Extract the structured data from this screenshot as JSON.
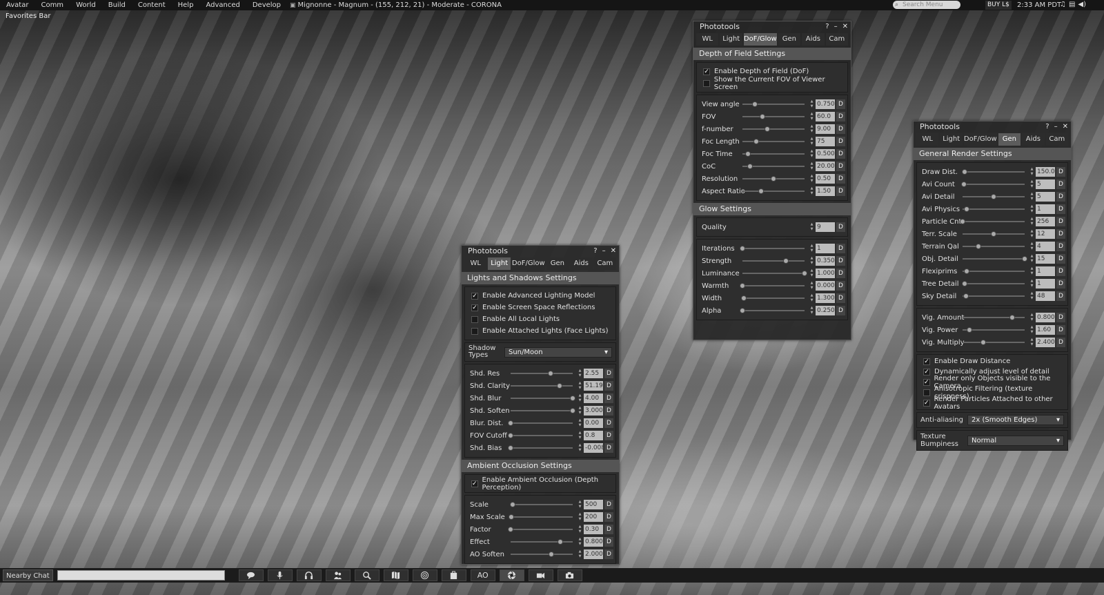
{
  "menubar": {
    "items": [
      "Avatar",
      "Comm",
      "World",
      "Build",
      "Content",
      "Help",
      "Advanced",
      "Develop"
    ],
    "location": "Mignonne - Magnum - (155, 212, 21) - Moderate - CORONA",
    "search_placeholder": "Search Menu",
    "buy_label": "BUY L$",
    "clock": "2:33 AM PDT"
  },
  "favorites_bar": "Favorites Bar",
  "tabs": [
    "WL",
    "Light",
    "DoF/Glow",
    "Gen",
    "Aids",
    "Cam"
  ],
  "light_panel": {
    "title": "Phototools",
    "active_tab": "Light",
    "section": "Lights and Shadows Settings",
    "checks": [
      {
        "label": "Enable Advanced Lighting Model",
        "checked": true
      },
      {
        "label": "Enable Screen Space Reflections",
        "checked": true
      },
      {
        "label": "Enable All Local Lights",
        "checked": false
      },
      {
        "label": "Enable Attached Lights (Face Lights)",
        "checked": false
      }
    ],
    "shadow_types_label": "Shadow Types",
    "shadow_types_value": "Sun/Moon",
    "sliders": [
      {
        "label": "Shd. Res",
        "value": "2.55",
        "pos": 0.64
      },
      {
        "label": "Shd. Clarity",
        "value": "51.19",
        "pos": 0.79
      },
      {
        "label": "Shd. Blur",
        "value": "4.00",
        "pos": 1.0
      },
      {
        "label": "Shd. Soften",
        "value": "3.000",
        "pos": 1.0
      },
      {
        "label": "Blur. Dist.",
        "value": "0.00",
        "pos": 0.0
      },
      {
        "label": "FOV Cutoff",
        "value": "0.8",
        "pos": 0.0
      },
      {
        "label": "Shd. Bias",
        "value": "-0.008",
        "pos": 0.0
      }
    ],
    "ao_section": "Ambient Occlusion Settings",
    "ao_check": {
      "label": "Enable Ambient Occlusion (Depth Perception)",
      "checked": true
    },
    "ao_sliders": [
      {
        "label": "Scale",
        "value": "500",
        "pos": 0.03
      },
      {
        "label": "Max Scale",
        "value": "200",
        "pos": 0.01
      },
      {
        "label": "Factor",
        "value": "0.30",
        "pos": 0.0
      },
      {
        "label": "Effect",
        "value": "0.800",
        "pos": 0.8
      },
      {
        "label": "AO Soften",
        "value": "2.000",
        "pos": 0.66
      }
    ]
  },
  "dof_panel": {
    "title": "Phototools",
    "active_tab": "DoF/Glow",
    "section": "Depth of Field Settings",
    "checks": [
      {
        "label": "Enable Depth of Field (DoF)",
        "checked": true
      },
      {
        "label": "Show the Current FOV of Viewer Screen",
        "checked": false
      }
    ],
    "sliders": [
      {
        "label": "View angle",
        "value": "0.750",
        "pos": 0.2
      },
      {
        "label": "FOV",
        "value": "60.0",
        "pos": 0.32
      },
      {
        "label": "f-number",
        "value": "9.00",
        "pos": 0.4
      },
      {
        "label": "Foc Length",
        "value": "75",
        "pos": 0.22
      },
      {
        "label": "Foc Time",
        "value": "0.500",
        "pos": 0.09
      },
      {
        "label": "CoC",
        "value": "20.00",
        "pos": 0.12
      },
      {
        "label": "Resolution",
        "value": "0.50",
        "pos": 0.5
      },
      {
        "label": "Aspect Ratio",
        "value": "1.50",
        "pos": 0.3
      }
    ],
    "glow_section": "Glow Settings",
    "quality": {
      "label": "Quality",
      "value": "9"
    },
    "glow_sliders": [
      {
        "label": "Iterations",
        "value": "1",
        "pos": 0.0
      },
      {
        "label": "Strength",
        "value": "0.350",
        "pos": 0.7
      },
      {
        "label": "Luminance",
        "value": "1.000",
        "pos": 1.0
      },
      {
        "label": "Warmth",
        "value": "0.000",
        "pos": 0.0
      },
      {
        "label": "Width",
        "value": "1.300",
        "pos": 0.02
      },
      {
        "label": "Alpha",
        "value": "0.250",
        "pos": 0.0
      }
    ]
  },
  "gen_panel": {
    "title": "Phototools",
    "active_tab": "Gen",
    "section": "General Render Settings",
    "sliders": [
      {
        "label": "Draw Dist.",
        "value": "150.0",
        "pos": 0.03
      },
      {
        "label": "Avi Count",
        "value": "5",
        "pos": 0.02
      },
      {
        "label": "Avi Detail",
        "value": "5",
        "pos": 0.5
      },
      {
        "label": "Avi Physics",
        "value": "1",
        "pos": 0.07
      },
      {
        "label": "Particle Cnt",
        "value": "256",
        "pos": 0.0
      },
      {
        "label": "Terr. Scale",
        "value": "12",
        "pos": 0.5
      },
      {
        "label": "Terrain Qal",
        "value": "4",
        "pos": 0.25
      },
      {
        "label": "Obj. Detail",
        "value": "15",
        "pos": 1.0
      },
      {
        "label": "Flexiprims",
        "value": "1",
        "pos": 0.07
      },
      {
        "label": "Tree Detail",
        "value": "1",
        "pos": 0.03
      },
      {
        "label": "Sky Detail",
        "value": "48",
        "pos": 0.05
      }
    ],
    "vig_sliders": [
      {
        "label": "Vig. Amount",
        "value": "0.800",
        "pos": 0.8
      },
      {
        "label": "Vig. Power",
        "value": "1.60",
        "pos": 0.11
      },
      {
        "label": "Vig. Multiply",
        "value": "2.400",
        "pos": 0.33
      }
    ],
    "checks": [
      {
        "label": "Enable Draw Distance",
        "checked": true
      },
      {
        "label": "Dynamically adjust level of detail",
        "checked": true
      },
      {
        "label": "Render only Objects visible to the Camera",
        "checked": true
      },
      {
        "label": "Anisotropic Filtering (texture crispness)",
        "checked": false
      },
      {
        "label": "Render Particles Attached to other Avatars",
        "checked": true
      }
    ],
    "antialias_label": "Anti-aliasing",
    "antialias_value": "2x (Smooth Edges)",
    "bump_label": "Texture Bumpiness",
    "bump_value": "Normal"
  },
  "bottombar": {
    "nearby_chat": "Nearby Chat",
    "buttons": [
      "chat-bubble-icon",
      "microphone-icon",
      "headphones-icon",
      "people-icon",
      "search-icon",
      "map-icon",
      "minimap-icon",
      "inventory-icon",
      "AO",
      "phototools-icon",
      "camera-video-icon",
      "snapshot-icon"
    ],
    "ao_label": "AO"
  }
}
